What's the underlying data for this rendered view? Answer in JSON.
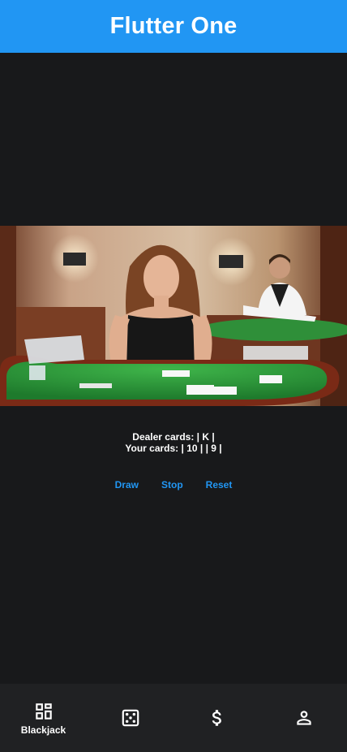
{
  "appbar": {
    "title": "Flutter One",
    "color": "#2196f3"
  },
  "hero": {
    "alt": "blackjack-table-dealers-photo"
  },
  "game": {
    "dealer_cards": "Dealer cards: | K |",
    "your_cards": "Your cards: | 10 | | 9 |"
  },
  "actions": {
    "draw_label": "Draw",
    "stop_label": "Stop",
    "reset_label": "Reset",
    "color": "#2196f3"
  },
  "bottom_nav": {
    "items": [
      {
        "label": "Blackjack",
        "icon": "dashboard-icon",
        "selected": true
      },
      {
        "label": "",
        "icon": "dice-icon",
        "selected": false
      },
      {
        "label": "",
        "icon": "dollar-icon",
        "selected": false
      },
      {
        "label": "",
        "icon": "person-icon",
        "selected": false
      }
    ]
  }
}
